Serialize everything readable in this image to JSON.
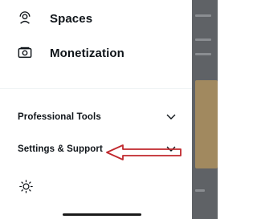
{
  "drawer": {
    "items": [
      {
        "label": "Spaces",
        "icon": "spaces-icon"
      },
      {
        "label": "Monetization",
        "icon": "monetization-icon"
      }
    ],
    "sections": [
      {
        "label": "Professional Tools",
        "icon": "chevron-down-icon"
      },
      {
        "label": "Settings & Support",
        "icon": "chevron-down-icon"
      }
    ],
    "footer_icon": "brightness-icon"
  },
  "annotation": {
    "icon": "red-arrow-annotation",
    "color": "#c0282d"
  },
  "colors": {
    "text": "#0f1419",
    "divider": "#eff3f4",
    "backdrop": "#5f6266"
  }
}
